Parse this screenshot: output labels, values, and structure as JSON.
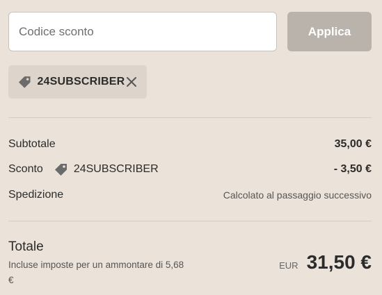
{
  "discount": {
    "input_placeholder": "Codice sconto",
    "input_value": "",
    "apply_label": "Applica",
    "applied_code": "24SUBSCRIBER"
  },
  "summary": {
    "subtotal_label": "Subtotale",
    "subtotal_value": "35,00 €",
    "discount_label": "Sconto",
    "discount_code": "24SUBSCRIBER",
    "discount_value": "- 3,50 €",
    "shipping_label": "Spedizione",
    "shipping_value": "Calcolato al passaggio successivo"
  },
  "total": {
    "label": "Totale",
    "tax_note": "Incluse imposte per un ammontare di 5,68 €",
    "currency": "EUR",
    "amount": "31,50 €"
  },
  "icons": {
    "tag": "tag-icon",
    "remove": "close-icon"
  },
  "colors": {
    "background": "#ebe3da",
    "apply_button": "#bab3ac",
    "chip": "#ddd5cc",
    "tag_icon": "#6b6b6b"
  }
}
